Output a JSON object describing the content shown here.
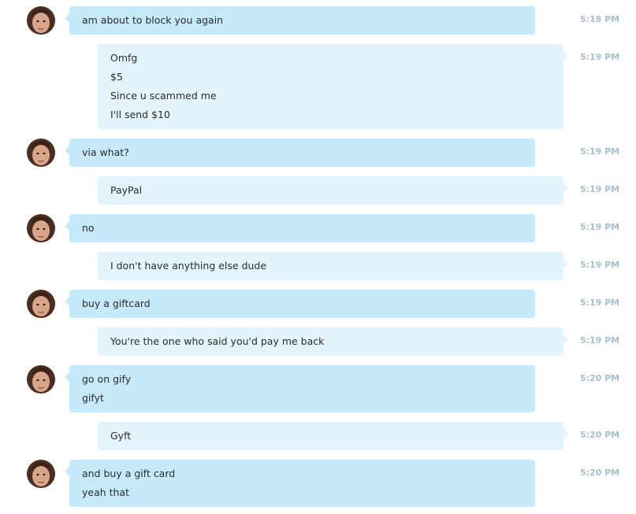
{
  "messages": [
    {
      "from": "them",
      "lines": [
        "am about to block you again"
      ],
      "time": "5:18 PM"
    },
    {
      "from": "me",
      "lines": [
        "Omfg",
        "$5",
        "Since u scammed me",
        "I'll send $10"
      ],
      "time": "5:19 PM"
    },
    {
      "from": "them",
      "lines": [
        "via what?"
      ],
      "time": "5:19 PM"
    },
    {
      "from": "me",
      "lines": [
        "PayPal"
      ],
      "time": "5:19 PM"
    },
    {
      "from": "them",
      "lines": [
        "no"
      ],
      "time": "5:19 PM"
    },
    {
      "from": "me",
      "lines": [
        "I don't have anything else dude"
      ],
      "time": "5:19 PM"
    },
    {
      "from": "them",
      "lines": [
        "buy a giftcard"
      ],
      "time": "5:19 PM"
    },
    {
      "from": "me",
      "lines": [
        "You're the one who said you'd pay me back"
      ],
      "time": "5:19 PM"
    },
    {
      "from": "them",
      "lines": [
        "go on gify",
        "gifyt"
      ],
      "time": "5:20 PM"
    },
    {
      "from": "me",
      "lines": [
        "Gyft"
      ],
      "time": "5:20 PM"
    },
    {
      "from": "them",
      "lines": [
        "and buy a gift card",
        "yeah that"
      ],
      "time": "5:20 PM"
    }
  ],
  "colors": {
    "incoming_bubble": "#c7eafb",
    "outgoing_bubble": "#e4f4fc",
    "timestamp": "#a9bfcc",
    "text": "#2b2b2b"
  }
}
